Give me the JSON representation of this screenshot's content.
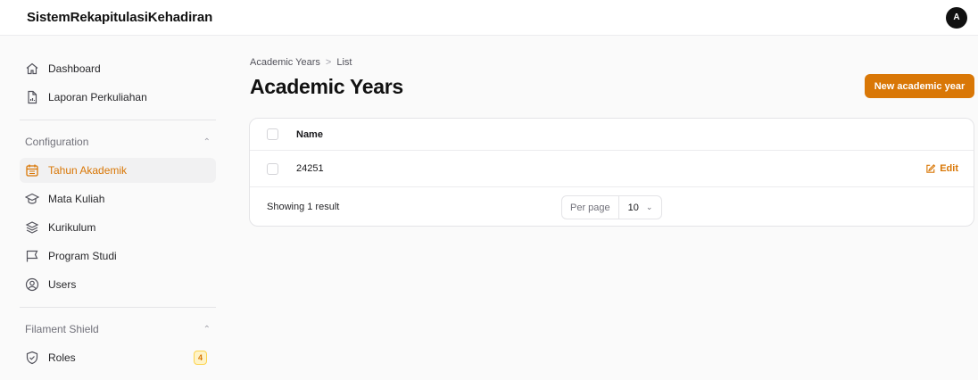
{
  "app": {
    "brand": "SistemRekapitulasiKehadiran",
    "avatar_initial": "A"
  },
  "sidebar": {
    "top_items": [
      {
        "label": "Dashboard",
        "icon": "home-icon"
      },
      {
        "label": "Laporan Perkuliahan",
        "icon": "document-chart-icon"
      }
    ],
    "groups": [
      {
        "label": "Configuration",
        "collapse_icon": "chevron-up-icon",
        "items": [
          {
            "label": "Tahun Akademik",
            "icon": "calendar-icon",
            "active": true
          },
          {
            "label": "Mata Kuliah",
            "icon": "academic-cap-icon"
          },
          {
            "label": "Kurikulum",
            "icon": "stack-icon"
          },
          {
            "label": "Program Studi",
            "icon": "flag-icon"
          },
          {
            "label": "Users",
            "icon": "user-circle-icon"
          }
        ]
      },
      {
        "label": "Filament Shield",
        "collapse_icon": "chevron-up-icon",
        "items": [
          {
            "label": "Roles",
            "icon": "shield-check-icon",
            "badge": "4"
          }
        ]
      }
    ]
  },
  "main": {
    "breadcrumb": [
      "Academic Years",
      "List"
    ],
    "breadcrumb_separator": ">",
    "title": "Academic Years",
    "primary_action": "New academic year",
    "table": {
      "columns": [
        "Name"
      ],
      "rows": [
        {
          "name": "24251",
          "action": "Edit"
        }
      ],
      "footer": {
        "summary": "Showing 1 result",
        "per_page_label": "Per page",
        "per_page_value": "10"
      }
    }
  },
  "colors": {
    "accent": "#d97706",
    "background": "#fafafa",
    "card": "#ffffff"
  }
}
